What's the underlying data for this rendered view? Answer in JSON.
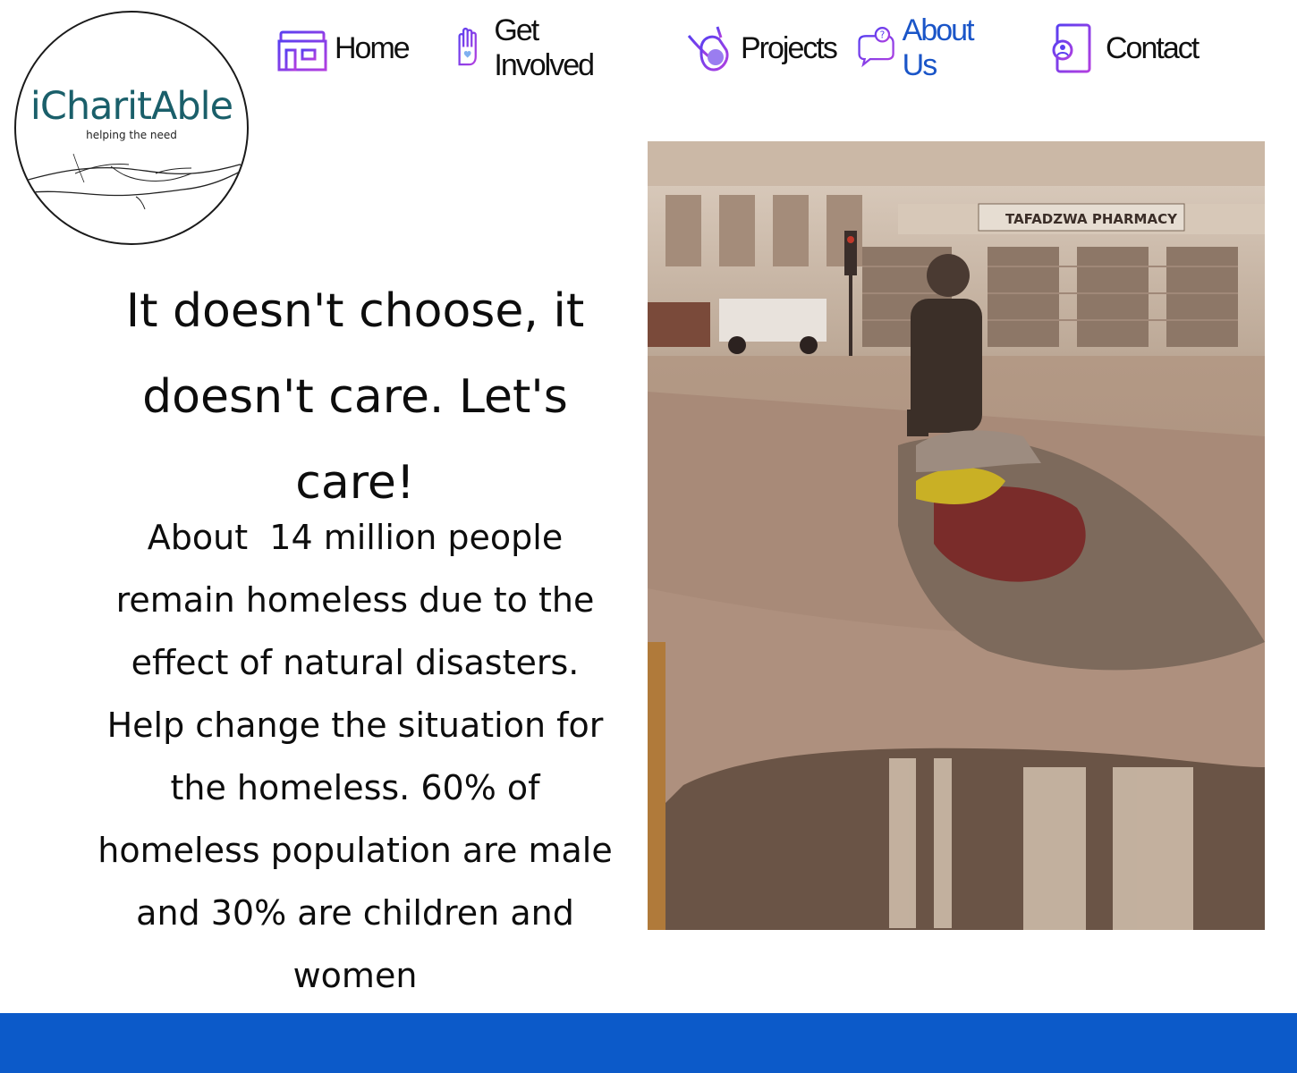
{
  "logo": {
    "brand": "iCharitAble",
    "tagline": "helping the need"
  },
  "nav": {
    "items": [
      {
        "label": "Home",
        "icon": "house-icon"
      },
      {
        "label": "Get Involved",
        "icon": "raised-hand-heart-icon"
      },
      {
        "label": "Projects",
        "icon": "hand-gesture-icon"
      },
      {
        "label": "About Us",
        "icon": "chat-question-icon",
        "active": true
      },
      {
        "label": "Contact",
        "icon": "address-book-icon"
      }
    ]
  },
  "main": {
    "headline": "It doesn't choose, it doesn't care. Let's care!",
    "body": "About  14 million people remain homeless due to the effect of natural disasters. Help change the situation for the homeless. 60% of homeless population are male and 30% are children and women"
  },
  "photo": {
    "storefront_sign": "TAFADZWA PHARMACY"
  },
  "colors": {
    "footer": "#0c5ac9",
    "nav_active": "#1a55c8",
    "icon_gradient_start": "#5a3ff0",
    "icon_gradient_end": "#b23fe0",
    "logo_brand": "#1a5f6a"
  }
}
